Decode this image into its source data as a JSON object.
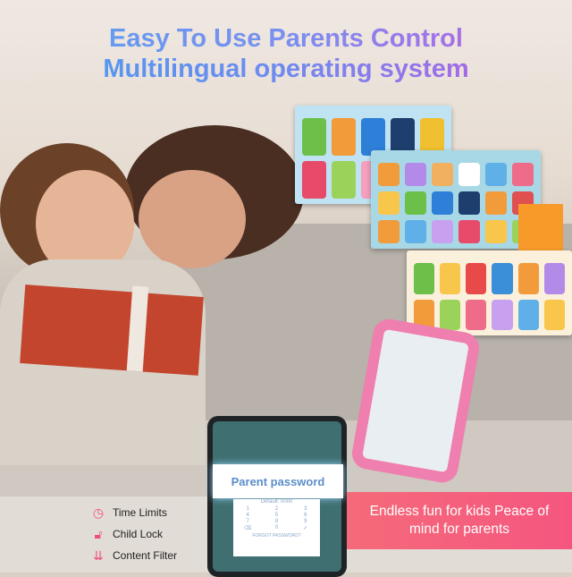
{
  "headline": {
    "line1": "Easy To Use Parents Control",
    "line2": "Multilingual operating system"
  },
  "tablet": {
    "dialog_title": "Parent password",
    "default_hint": "Default: 0000",
    "keys": [
      "1",
      "2",
      "3",
      "4",
      "5",
      "6",
      "7",
      "8",
      "9",
      "⌫",
      "0",
      "✓"
    ],
    "forgot": "FORGOT PASSWORD?"
  },
  "features": [
    {
      "label": "Time Limits",
      "icon": "clock-icon"
    },
    {
      "label": "Child Lock",
      "icon": "unlock-icon"
    },
    {
      "label": "Content Filter",
      "icon": "filter-arrows-icon"
    }
  ],
  "banner": {
    "text": "Endless fun for kids Peace of mind for parents"
  },
  "colors": {
    "accent_pink": "#f5567f",
    "headline_blue": "#5aa0f0",
    "headline_purple": "#c25be0",
    "tablet_screen": "#3f6f70"
  }
}
